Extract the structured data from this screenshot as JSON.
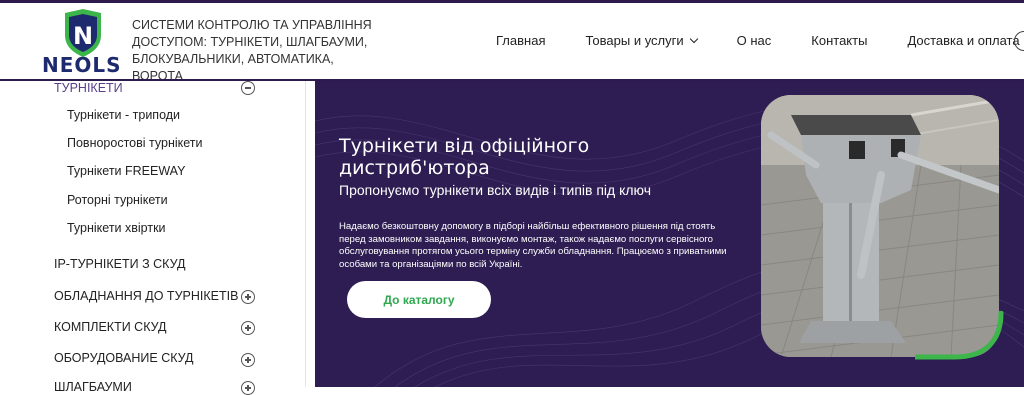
{
  "brand": {
    "name_part1": "NEO",
    "name_part2": "LS",
    "logo_letter": "N",
    "colors": {
      "dark": "#1e2a6e",
      "green": "#3cb54a",
      "purple": "#2e1d52"
    }
  },
  "header": {
    "tagline": "СИСТЕМИ КОНТРОЛЮ ТА УПРАВЛІННЯ ДОСТУПОМ: ТУРНІКЕТИ, ШЛАГБАУМИ, БЛОКУВАЛЬНИКИ, АВТОМАТИКА, ВОРОТА"
  },
  "nav": {
    "items": [
      {
        "label": "Главная",
        "icon": ""
      },
      {
        "label": "Товары и услуги",
        "icon": "chevron-down-icon"
      },
      {
        "label": "О нас",
        "icon": ""
      },
      {
        "label": "Контакты",
        "icon": ""
      },
      {
        "label": "Доставка и оплата",
        "icon": ""
      }
    ]
  },
  "sidebar": {
    "active_category": {
      "label": "ТУРНІКЕТИ",
      "icon": "collapse-icon"
    },
    "subitems": [
      {
        "label": "Турнікети - триподи"
      },
      {
        "label": "Повноростові турнікети"
      },
      {
        "label": "Турнікети FREEWAY"
      },
      {
        "label": "Роторні турнікети"
      },
      {
        "label": "Турнікети хвіртки"
      }
    ],
    "categories": [
      {
        "label": "IP-ТУРНІКЕТИ З СКУД",
        "icon": ""
      },
      {
        "label": "ОБЛАДНАННЯ ДО ТУРНІКЕТІВ",
        "icon": "expand-icon"
      },
      {
        "label": "КОМПЛЕКТИ СКУД",
        "icon": "expand-icon"
      },
      {
        "label": "ОБОРУДОВАНИЕ СКУД",
        "icon": "expand-icon"
      },
      {
        "label": "ШЛАГБАУМИ",
        "icon": "expand-icon"
      }
    ]
  },
  "hero": {
    "title": "Турнікети від офіційного дистриб'ютора",
    "subtitle": "Пропонуємо турнікети всіх видів і типів під ключ",
    "description": "Надаємо безкоштовну допомогу в підборі найбільш ефективного рішення під стоять перед замовником завдання, виконуємо монтаж, також надаємо послуги сервісного обслуговування протягом усього терміну служби обладнання. Працюємо з приватними особами та організаціями по всій Україні.",
    "cta_label": "До каталогу",
    "image_subject": "tripod-turnstile-photo"
  }
}
